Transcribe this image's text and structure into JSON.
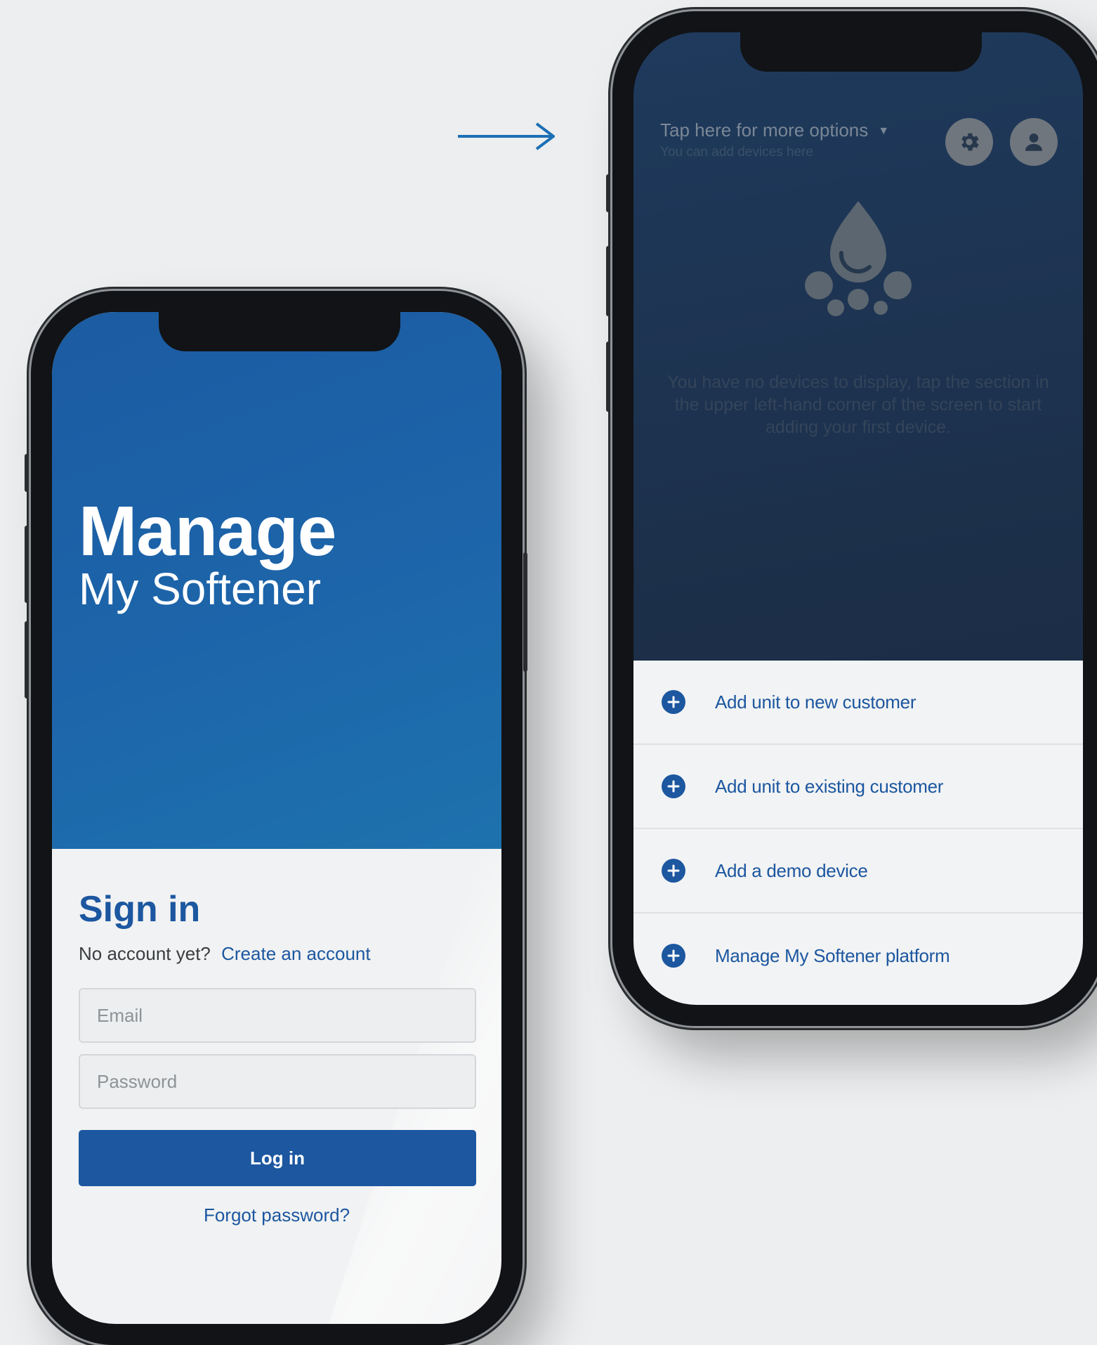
{
  "left_screen": {
    "brand_main": "Manage",
    "brand_sub": "My Softener",
    "signin_title": "Sign in",
    "no_account_text": "No account yet?",
    "create_account_link": "Create an account",
    "email_placeholder": "Email",
    "password_placeholder": "Password",
    "login_button": "Log in",
    "forgot_password": "Forgot password?"
  },
  "right_screen": {
    "options_title": "Tap here for more options",
    "options_subtitle": "You can add devices here",
    "settings_icon": "gear-icon",
    "profile_icon": "user-icon",
    "empty_message": "You have no devices to display, tap the section in the upper left-hand corner of the screen to start adding your first device.",
    "menu_items": [
      {
        "label": "Add unit to new customer",
        "icon": "plus-circle-icon"
      },
      {
        "label": "Add unit to existing customer",
        "icon": "plus-circle-icon"
      },
      {
        "label": "Add a demo device",
        "icon": "plus-circle-icon"
      },
      {
        "label": "Manage My Softener platform",
        "icon": "plus-circle-icon"
      }
    ]
  },
  "colors": {
    "brand_blue": "#1c57a0",
    "hero_blue": "#1d65aa",
    "dark_navy": "#1c2f49",
    "sheet_bg": "#f2f3f4",
    "page_bg": "#eceeef"
  }
}
